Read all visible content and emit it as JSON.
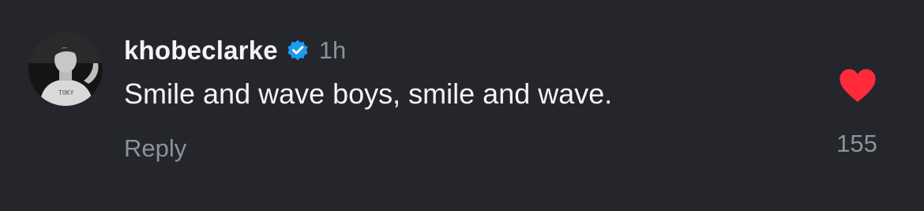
{
  "comment": {
    "username": "khobeclarke",
    "verified": true,
    "time_ago": "1h",
    "text": "Smile and wave boys, smile and wave.",
    "reply_label": "Reply",
    "like_count": "155",
    "liked": true,
    "avatar_icon": "profile-photo-avatar",
    "verified_icon": "verified-badge-icon",
    "like_icon": "heart-icon",
    "colors": {
      "background": "#24262b",
      "verified": "#1d9bf0",
      "heart": "#ff2b3d",
      "secondary_text": "#8d9299"
    }
  }
}
